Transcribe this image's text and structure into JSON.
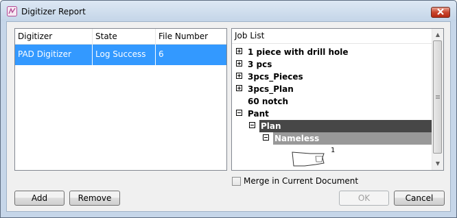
{
  "window": {
    "title": "Digitizer Report",
    "accent_color": "#3399ff"
  },
  "digitizer_table": {
    "columns": [
      "Digitizer",
      "State",
      "File Number"
    ],
    "rows": [
      {
        "digitizer": "PAD Digitizer Table",
        "state": "Log Success",
        "file_number": "6",
        "selected": true
      }
    ]
  },
  "job_list": {
    "header": "Job List",
    "nodes": [
      {
        "label": "1 piece with drill hole",
        "expander": "plus"
      },
      {
        "label": "3 pcs",
        "expander": "plus"
      },
      {
        "label": "3pcs_Pieces",
        "expander": "plus"
      },
      {
        "label": "3pcs_Plan",
        "expander": "plus"
      },
      {
        "label": "60 notch",
        "expander": "none"
      },
      {
        "label": "Pant",
        "expander": "minus"
      },
      {
        "label": "Plan",
        "expander": "minus",
        "highlight": "#474747"
      },
      {
        "label": "Nameless",
        "expander": "minus",
        "highlight": "#999999"
      }
    ],
    "piece_preview": {
      "count_label": "1"
    }
  },
  "merge_checkbox": {
    "label": "Merge in Current Document",
    "checked": false
  },
  "buttons": {
    "add": "Add",
    "remove": "Remove",
    "ok": "OK",
    "cancel": "Cancel"
  },
  "icons": {
    "app": "digitizer-app-icon",
    "close": "close-x-icon",
    "scroll_up": "arrow-up-icon",
    "scroll_down": "arrow-down-icon"
  }
}
